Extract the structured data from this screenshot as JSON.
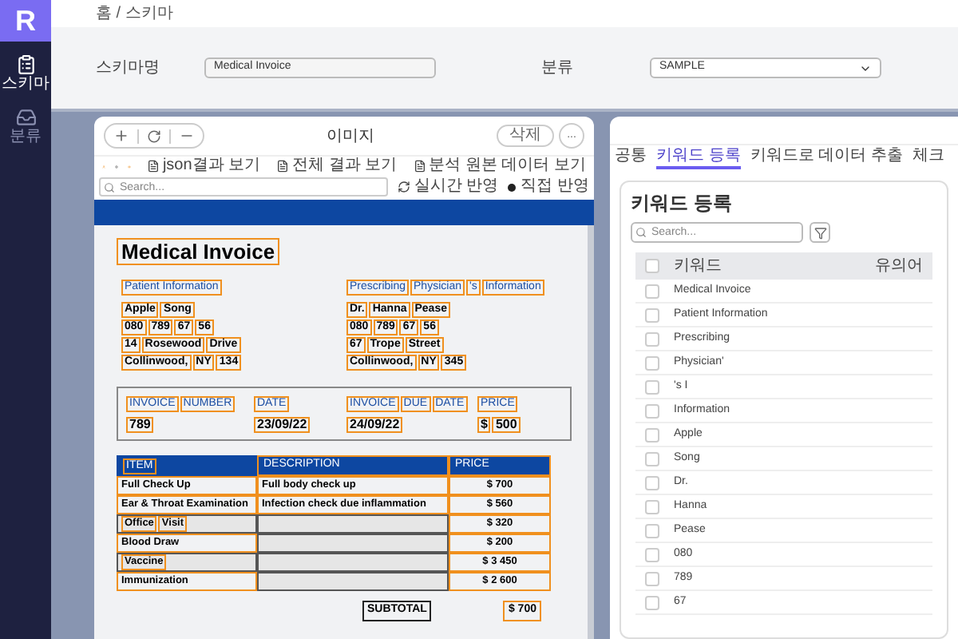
{
  "logo": "R",
  "sidebar": {
    "items": [
      {
        "label": "스키마",
        "kind": "schema",
        "selected": true
      },
      {
        "label": "분류",
        "kind": "tray",
        "selected": false
      }
    ]
  },
  "breadcrumb": "홈 / 스키마",
  "form": {
    "schema_label": "스키마명",
    "schema_value": "Medical Invoice",
    "category_label": "분류",
    "category_value": "SAMPLE"
  },
  "image_panel": {
    "title": "이미지",
    "delete_button": "삭제",
    "more_button": "...",
    "views": [
      "json결과 보기",
      "전체 결과 보기",
      "분석 원본 데이터 보기"
    ],
    "search": {
      "placeholder": "Search..."
    },
    "realtime": "실시간 반영",
    "manual": "직접 반영",
    "document": {
      "title": "Medical Invoice",
      "patient": {
        "heading": [
          "Patient Information"
        ],
        "lines": [
          [
            "Apple",
            "Song"
          ],
          [
            "080",
            "789",
            "67",
            "56"
          ],
          [
            "14",
            "Rosewood",
            "Drive"
          ],
          [
            "Collinwood,",
            "NY",
            "134"
          ]
        ]
      },
      "physician": {
        "heading": [
          "Prescribing",
          "Physician",
          "'s",
          "Information"
        ],
        "lines": [
          [
            "Dr.",
            "Hanna",
            "Pease"
          ],
          [
            "080",
            "789",
            "67",
            "56"
          ],
          [
            "67",
            "Trope",
            "Street"
          ],
          [
            "Collinwood,",
            "NY",
            "345"
          ]
        ]
      },
      "summary": [
        {
          "label": [
            "INVOICE",
            "NUMBER"
          ],
          "value": [
            "789"
          ]
        },
        {
          "label": [
            "DATE"
          ],
          "value": [
            "23/09/22"
          ]
        },
        {
          "label": [
            "INVOICE",
            "DUE",
            "DATE"
          ],
          "value": [
            "24/09/22"
          ]
        },
        {
          "label": [
            "PRICE"
          ],
          "value": [
            "$",
            "500"
          ]
        }
      ],
      "columns": [
        {
          "words": [
            "ITEM"
          ],
          "boxed": false
        },
        {
          "words": [
            "DESCRIPTION"
          ],
          "boxed": true
        },
        {
          "words": [
            "PRICE"
          ],
          "boxed": true
        }
      ],
      "rows": [
        [
          {
            "words": [
              "Full Check Up"
            ],
            "boxed": true
          },
          {
            "words": [
              "Full body check up"
            ],
            "boxed": true
          },
          {
            "words": [
              "$ 700"
            ],
            "boxed": true
          }
        ],
        [
          {
            "words": [
              "Ear & Throat Examination"
            ],
            "boxed": true
          },
          {
            "words": [
              "Infection check due inflammation"
            ],
            "boxed": true
          },
          {
            "words": [
              "$ 560"
            ],
            "boxed": true
          }
        ],
        [
          {
            "words": [
              "Office",
              "Visit"
            ],
            "boxed": false
          },
          {
            "boxed": false
          },
          {
            "words": [
              "$ 320"
            ],
            "boxed": true
          }
        ],
        [
          {
            "words": [
              "Blood Draw"
            ],
            "boxed": true
          },
          {
            "boxed": false
          },
          {
            "words": [
              "$ 200"
            ],
            "boxed": true
          }
        ],
        [
          {
            "words": [
              "Vaccine"
            ],
            "boxed": false
          },
          {
            "boxed": false
          },
          {
            "words": [
              "$ 3 450"
            ],
            "boxed": true
          }
        ],
        [
          {
            "words": [
              "Immunization"
            ],
            "boxed": true
          },
          {
            "boxed": false
          },
          {
            "words": [
              "$ 2 600"
            ],
            "boxed": true
          }
        ]
      ],
      "subtotal_label": "SUBTOTAL",
      "subtotal_value": "$ 700"
    }
  },
  "keyword_panel": {
    "tabs": [
      {
        "label": "공통",
        "selected": false
      },
      {
        "label": "키워드 등록",
        "selected": true
      },
      {
        "label": "키워드로 데이터 추출",
        "selected": false
      },
      {
        "label": "체크",
        "selected": false
      }
    ],
    "title": "키워드 등록",
    "search": {
      "placeholder": "Search..."
    },
    "columns": [
      "키워드",
      "유의어"
    ],
    "all_checked": false,
    "rows": [
      {
        "keyword": "Medical Invoice",
        "checked": false
      },
      {
        "keyword": "Patient Information",
        "checked": false
      },
      {
        "keyword": "Prescribing",
        "checked": false
      },
      {
        "keyword": "Physician'",
        "checked": false
      },
      {
        "keyword": "'s I",
        "checked": false
      },
      {
        "keyword": "Information",
        "checked": false
      },
      {
        "keyword": "Apple",
        "checked": false
      },
      {
        "keyword": "Song",
        "checked": false
      },
      {
        "keyword": "Dr.",
        "checked": false
      },
      {
        "keyword": "Hanna",
        "checked": false
      },
      {
        "keyword": "Pease",
        "checked": false
      },
      {
        "keyword": "080",
        "checked": false
      },
      {
        "keyword": "789",
        "checked": false
      },
      {
        "keyword": "67",
        "checked": false
      }
    ]
  }
}
